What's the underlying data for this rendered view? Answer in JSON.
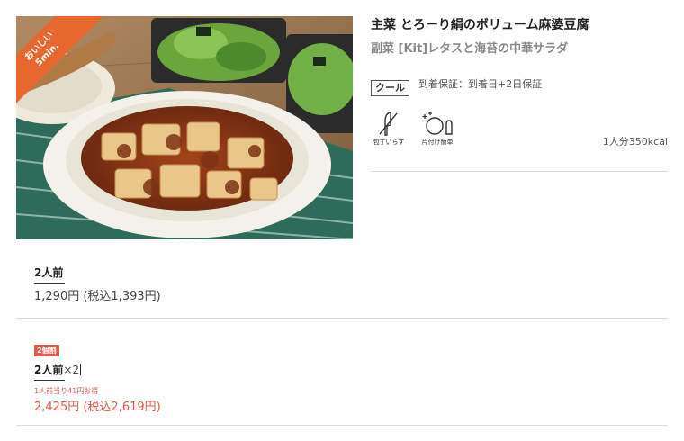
{
  "product": {
    "main_title": "主菜 とろーり絹のボリューム麻婆豆腐",
    "sub_title": "副菜 [Kit]レタスと海苔の中華サラダ",
    "badge": {
      "line1": "おいしい",
      "line2": "5min."
    },
    "cool_label": "クール",
    "delivery": "到着保証：到着日+2日保証",
    "features": [
      {
        "icon": "knife-crossed-icon",
        "label": "包丁いらず"
      },
      {
        "icon": "plate-cleanup-icon",
        "label": "片付け簡単"
      }
    ],
    "calories": "1人分350kcal"
  },
  "options": [
    {
      "label": "2人前",
      "price": "1,290円 (税込1,393円)"
    },
    {
      "badge": "2個割",
      "label": "2人前",
      "qty": "×2",
      "note": "1人前当り41円お得",
      "price": "2,425円 (税込2,619円)"
    }
  ],
  "colors": {
    "accent": "#e05a4a",
    "ribbon": "#e8672e"
  }
}
